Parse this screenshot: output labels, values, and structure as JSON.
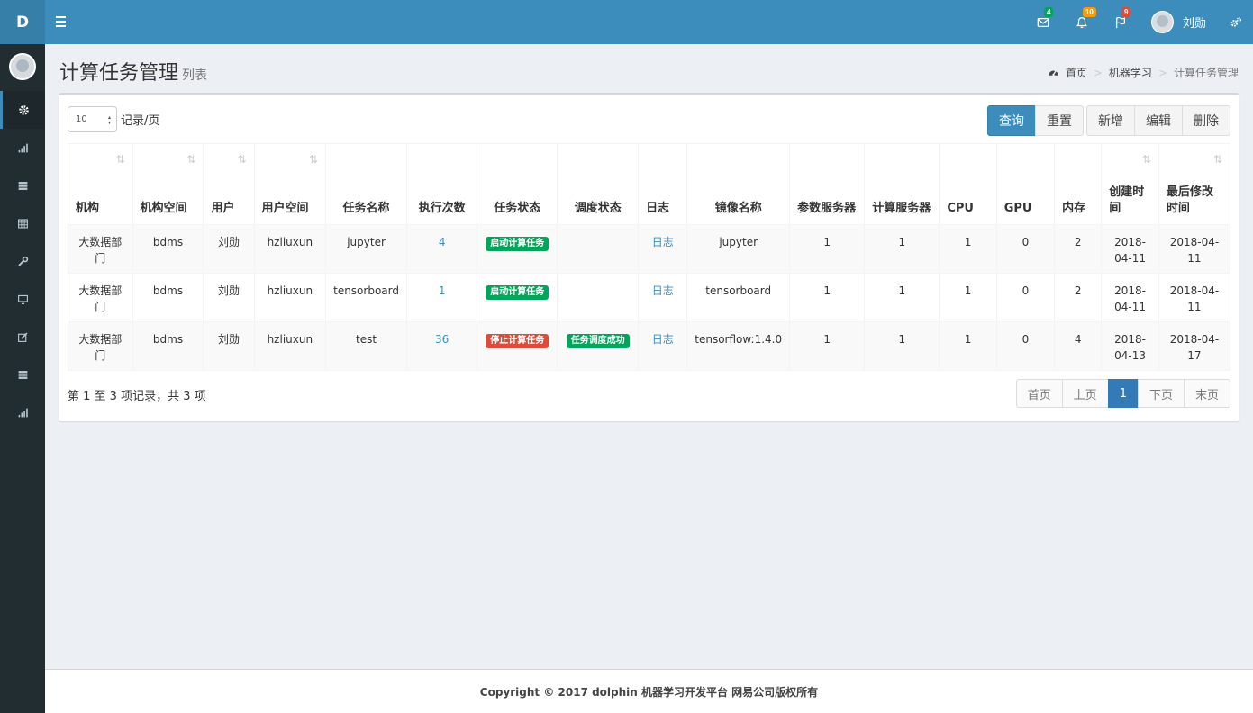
{
  "brand": {
    "logo_text": "D"
  },
  "header": {
    "messages_count": "4",
    "notifications_count": "10",
    "tasks_count": "9",
    "user_name": "刘勋",
    "colors": {
      "messages_badge": "#00a65a",
      "notifications_badge": "#f39c12",
      "tasks_badge": "#dd4b39"
    }
  },
  "sidebar": {
    "items": [
      {
        "icon": "gear-icon",
        "active": true
      },
      {
        "icon": "bar-chart-icon"
      },
      {
        "icon": "server-icon"
      },
      {
        "icon": "table-icon"
      },
      {
        "icon": "wrench-icon"
      },
      {
        "icon": "desktop-icon"
      },
      {
        "icon": "edit-icon"
      },
      {
        "icon": "server-icon"
      },
      {
        "icon": "bar-chart-icon"
      }
    ]
  },
  "page": {
    "title": "计算任务管理",
    "subtitle": "列表",
    "breadcrumb": [
      "首页",
      "机器学习",
      "计算任务管理"
    ]
  },
  "toolbar": {
    "page_length": "10",
    "page_length_label": "记录/页",
    "query": "查询",
    "reset": "重置",
    "add": "新增",
    "edit": "编辑",
    "delete": "删除"
  },
  "table": {
    "columns": [
      {
        "label": "机构",
        "sortable": true
      },
      {
        "label": "机构空间",
        "sortable": true
      },
      {
        "label": "用户",
        "sortable": true
      },
      {
        "label": "用户空间",
        "sortable": true
      },
      {
        "label": "任务名称",
        "sortable": false
      },
      {
        "label": "执行次数",
        "sortable": false
      },
      {
        "label": "任务状态",
        "sortable": false
      },
      {
        "label": "调度状态",
        "sortable": false
      },
      {
        "label": "日志",
        "sortable": false
      },
      {
        "label": "镜像名称",
        "sortable": false
      },
      {
        "label": "参数服务器",
        "sortable": false
      },
      {
        "label": "计算服务器",
        "sortable": false
      },
      {
        "label": "CPU",
        "sortable": false
      },
      {
        "label": "GPU",
        "sortable": false
      },
      {
        "label": "内存",
        "sortable": false
      },
      {
        "label": "创建时间",
        "sortable": true
      },
      {
        "label": "最后修改时间",
        "sortable": true
      }
    ],
    "rows": [
      {
        "org": "大数据部门",
        "org_space": "bdms",
        "user": "刘勋",
        "user_space": "hzliuxun",
        "task_name": "jupyter",
        "exec_count": "4",
        "task_status": "启动计算任务",
        "task_status_color": "#00a65a",
        "schedule_status": "",
        "log": "日志",
        "image": "jupyter",
        "ps": "1",
        "worker": "1",
        "cpu": "1",
        "gpu": "0",
        "memory": "2",
        "created": "2018-04-11",
        "modified": "2018-04-11"
      },
      {
        "org": "大数据部门",
        "org_space": "bdms",
        "user": "刘勋",
        "user_space": "hzliuxun",
        "task_name": "tensorboard",
        "exec_count": "1",
        "task_status": "启动计算任务",
        "task_status_color": "#00a65a",
        "schedule_status": "",
        "log": "日志",
        "image": "tensorboard",
        "ps": "1",
        "worker": "1",
        "cpu": "1",
        "gpu": "0",
        "memory": "2",
        "created": "2018-04-11",
        "modified": "2018-04-11"
      },
      {
        "org": "大数据部门",
        "org_space": "bdms",
        "user": "刘勋",
        "user_space": "hzliuxun",
        "task_name": "test",
        "exec_count": "36",
        "task_status": "停止计算任务",
        "task_status_color": "#dd4b39",
        "schedule_status": "任务调度成功",
        "log": "日志",
        "image": "tensorflow:1.4.0",
        "ps": "1",
        "worker": "1",
        "cpu": "1",
        "gpu": "0",
        "memory": "4",
        "created": "2018-04-13",
        "modified": "2018-04-17"
      }
    ]
  },
  "pagination": {
    "info": "第 1 至 3 项记录，共 3 项",
    "first": "首页",
    "prev": "上页",
    "current": "1",
    "next": "下页",
    "last": "末页"
  },
  "footer": {
    "copyright": "Copyright © 2017 dolphin 机器学习开发平台 网易公司版权所有"
  }
}
